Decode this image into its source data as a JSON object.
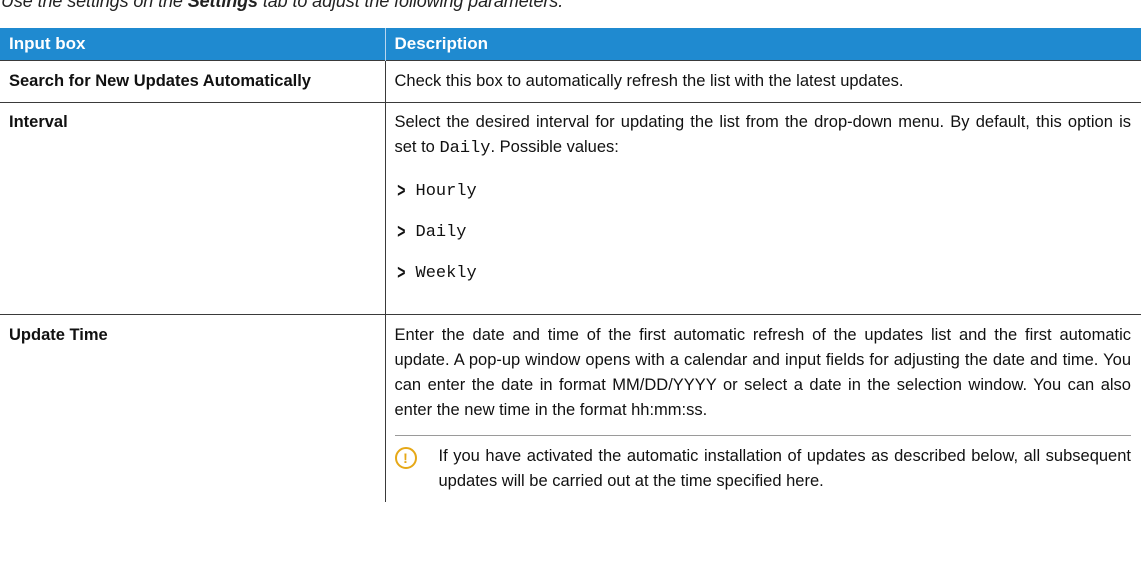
{
  "intro": {
    "before": "Use the settings on the ",
    "tab_name": "Settings",
    "after": " tab to adjust the following parameters."
  },
  "table": {
    "headers": [
      "Input box",
      "Description"
    ],
    "rows": [
      {
        "name": "Search for New Updates Automatically",
        "description": "Check this box to automatically refresh the list with the latest updates."
      },
      {
        "name": "Interval",
        "description_before": "Select the desired interval for updating the list from the drop-down menu. By default, this option is set to ",
        "default_value": "Daily",
        "description_after": ". Possible values:",
        "values": [
          "Hourly",
          "Daily",
          "Weekly"
        ]
      },
      {
        "name": "Update Time",
        "description": "Enter the date and time of the first automatic refresh of the updates list and the first automatic update. A pop-up window opens with a calendar and input fields for adjusting the date and time. You can enter the date in format MM/DD/YYYY or select a date in the selection window. You can also enter the new time in the format hh:mm:ss.",
        "note_icon": "info-icon",
        "note": "If you have activated the automatic installation of updates as described below, all subsequent updates will be carried out at the time specified here."
      }
    ]
  },
  "colors": {
    "header_bg": "#1f8ad0",
    "note_icon": "#e6a817"
  }
}
